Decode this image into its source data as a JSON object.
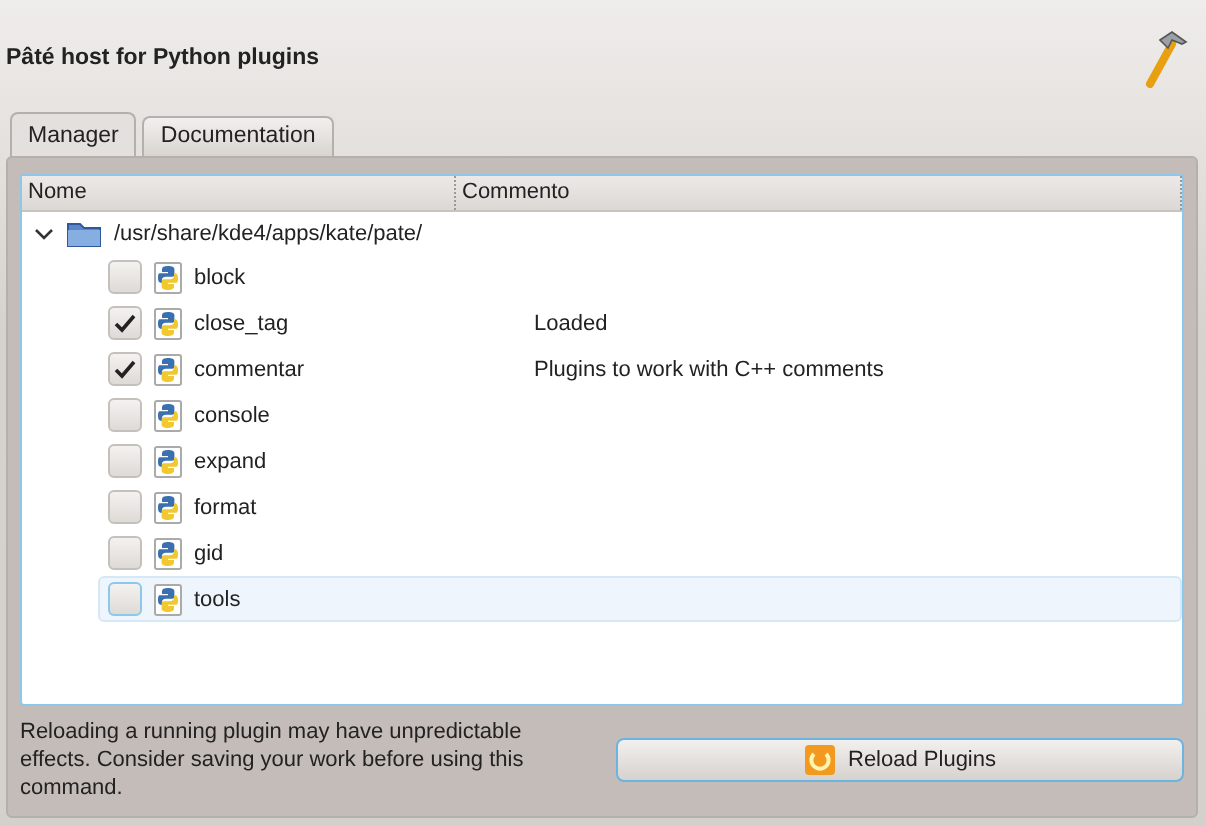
{
  "window": {
    "title": "Pâté host for Python plugins"
  },
  "tabs": [
    {
      "label": "Manager",
      "selected": true
    },
    {
      "label": "Documentation",
      "selected": false
    }
  ],
  "tree": {
    "columns": [
      "Nome",
      "Commento"
    ],
    "root": {
      "label": "/usr/share/kde4/apps/kate/pate/",
      "expanded": true,
      "children": [
        {
          "name": "block",
          "checked": false,
          "selected": false
        },
        {
          "name": "close_tag",
          "checked": true,
          "comment": "Loaded",
          "selected": false
        },
        {
          "name": "commentar",
          "checked": true,
          "comment": "Plugins to work with C++ comments",
          "selected": false
        },
        {
          "name": "console",
          "checked": false,
          "selected": false
        },
        {
          "name": "expand",
          "checked": false,
          "selected": false
        },
        {
          "name": "format",
          "checked": false,
          "selected": false
        },
        {
          "name": "gid",
          "checked": false,
          "selected": false
        },
        {
          "name": "tools",
          "checked": false,
          "selected": true
        }
      ]
    }
  },
  "notice": "Reloading a running plugin may have unpredictable effects. Consider saving your work before using this command.",
  "reload_button": "Reload Plugins"
}
